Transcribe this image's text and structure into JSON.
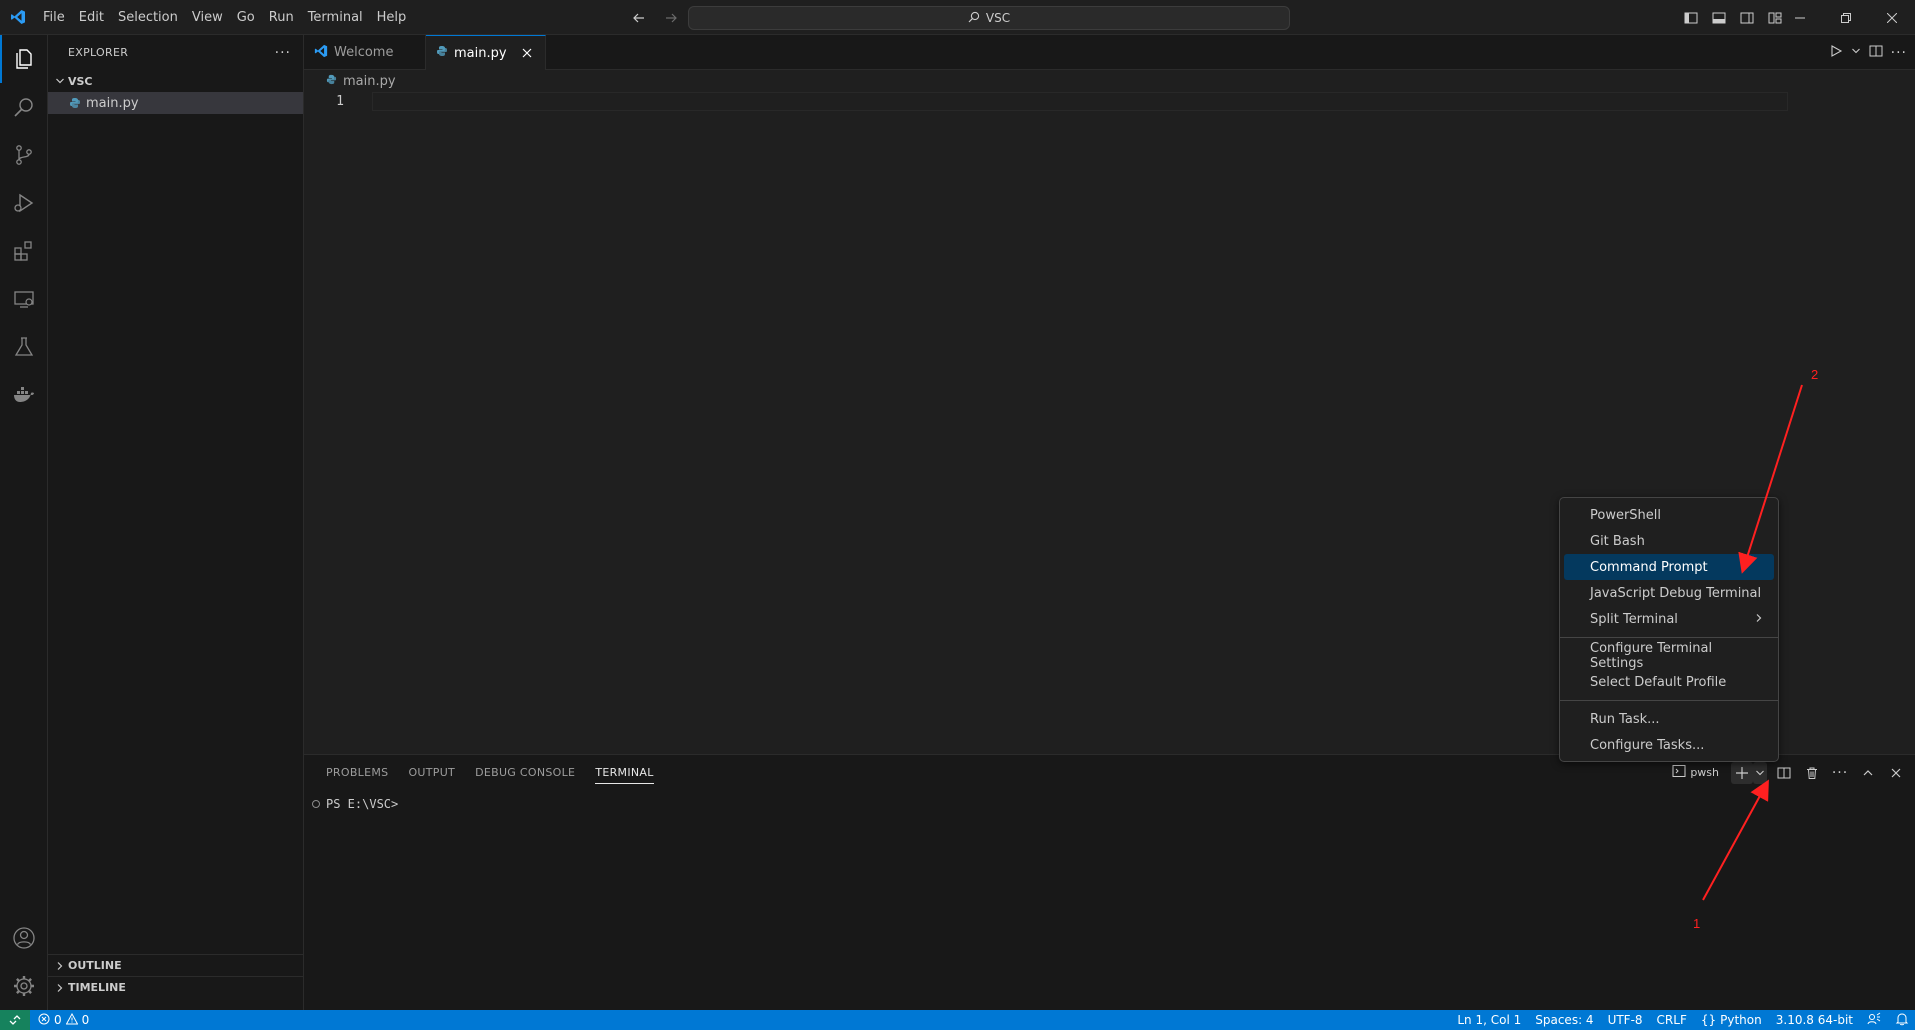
{
  "titlebar": {
    "menu": [
      "File",
      "Edit",
      "Selection",
      "View",
      "Go",
      "Run",
      "Terminal",
      "Help"
    ],
    "search_text": "VSC"
  },
  "sidebar": {
    "title": "EXPLORER",
    "folder": "VSC",
    "files": [
      "main.py"
    ],
    "outline_label": "OUTLINE",
    "timeline_label": "TIMELINE"
  },
  "editor": {
    "tabs": [
      {
        "label": "Welcome",
        "active": false
      },
      {
        "label": "main.py",
        "active": true
      }
    ],
    "breadcrumb": "main.py",
    "line_number": "1"
  },
  "panel": {
    "tabs": [
      "PROBLEMS",
      "OUTPUT",
      "DEBUG CONSOLE",
      "TERMINAL"
    ],
    "active_tab": "TERMINAL",
    "terminal_name": "pwsh",
    "terminal_prompt": "PS E:\\VSC>"
  },
  "context_menu": {
    "group1": [
      "PowerShell",
      "Git Bash",
      "Command Prompt",
      "JavaScript Debug Terminal",
      "Split Terminal"
    ],
    "group2": [
      "Configure Terminal Settings",
      "Select Default Profile"
    ],
    "group3": [
      "Run Task...",
      "Configure Tasks..."
    ],
    "highlighted": "Command Prompt"
  },
  "statusbar": {
    "errors": "0",
    "warnings": "0",
    "position": "Ln 1, Col 1",
    "spaces": "Spaces: 4",
    "encoding": "UTF-8",
    "eol": "CRLF",
    "language": "Python",
    "interpreter": "3.10.8 64-bit"
  },
  "annotations": {
    "label_1": "1",
    "label_2": "2"
  },
  "colors": {
    "accent": "#0078d4",
    "python_icon": "#519aba",
    "annotation": "#ff2020"
  }
}
